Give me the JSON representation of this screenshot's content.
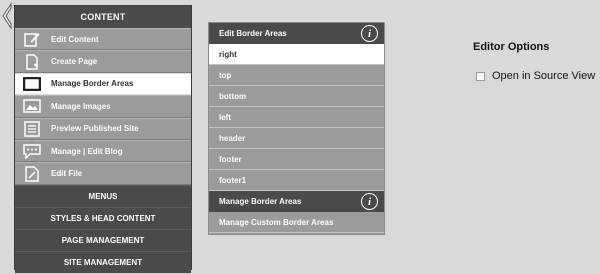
{
  "left_panel": {
    "header": "CONTENT",
    "items": [
      {
        "label": "Edit Content",
        "icon": "edit-pencil-icon"
      },
      {
        "label": "Create Page",
        "icon": "new-page-icon"
      },
      {
        "label": "Manage Border Areas",
        "icon": "border-areas-icon",
        "active": true
      },
      {
        "label": "Manage Images",
        "icon": "image-icon"
      },
      {
        "label": "Preview Published Site",
        "icon": "list-document-icon"
      },
      {
        "label": "Manage | Edit Blog",
        "icon": "speech-bubble-icon"
      },
      {
        "label": "Edit File",
        "icon": "file-edit-icon"
      }
    ],
    "sections": [
      "MENUS",
      "STYLES & HEAD CONTENT",
      "PAGE MANAGEMENT",
      "SITE MANAGEMENT"
    ]
  },
  "middle_panel": {
    "header": "Edit Border Areas",
    "items": [
      "right",
      "top",
      "bottom",
      "left",
      "header",
      "footer",
      "footer1"
    ],
    "active_item": "right",
    "section_header": "Manage Border Areas",
    "section_items": [
      "Manage Custom Border Areas"
    ]
  },
  "options": {
    "title": "Editor Options",
    "source_view_label": "Open in Source View",
    "source_view_checked": false
  },
  "colors": {
    "dark": "#4a4a4a",
    "item_bg": "#9b9b9b",
    "page_bg": "#d9d9d9"
  }
}
